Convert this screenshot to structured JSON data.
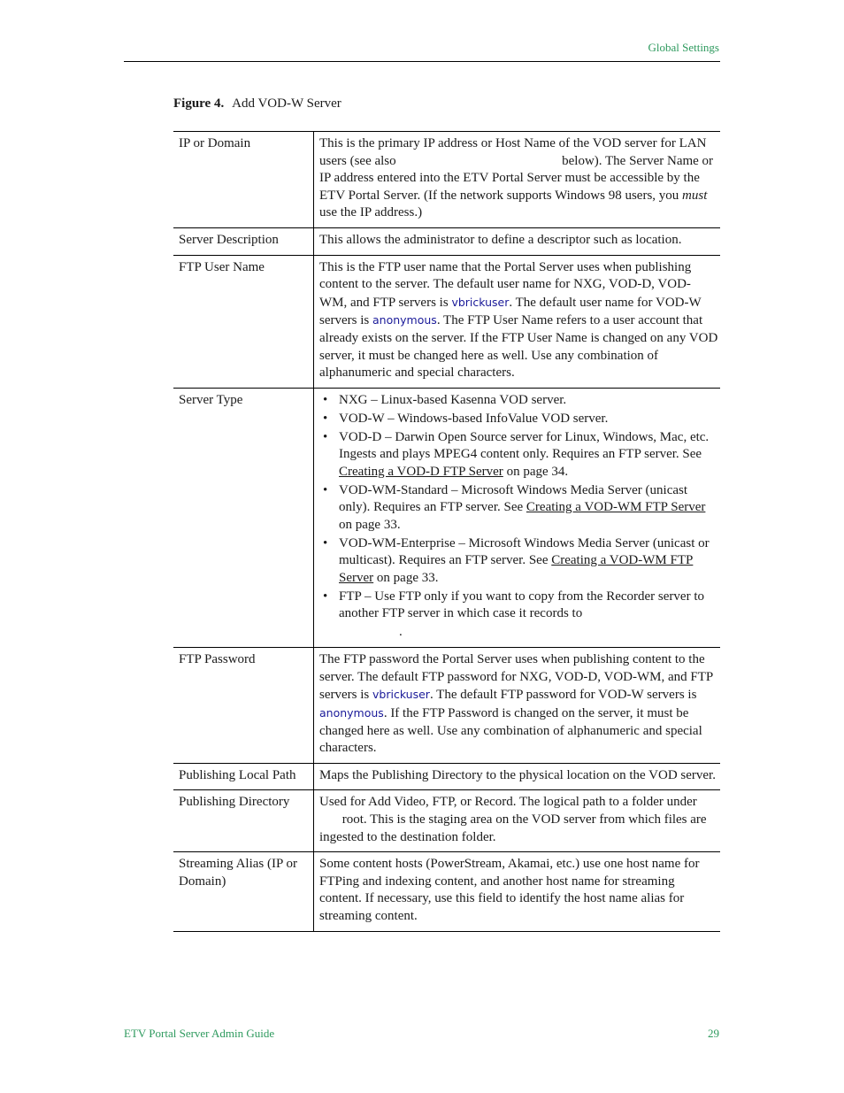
{
  "header": {
    "section_title": "Global Settings"
  },
  "figure": {
    "number": "Figure 4.",
    "title": "Add VOD-W Server"
  },
  "rows": [
    {
      "label": "IP or Domain",
      "p1": "This is the primary IP address or Host Name of the VOD server for LAN users (see also",
      "p2": "below). The Server Name or IP address entered into the ETV Portal Server must be accessible by the ETV Portal Server. (If the network supports Windows 98 users, you",
      "em": "must",
      "p3": "use the IP address.)"
    },
    {
      "label": "Server Description",
      "text": "This allows the administrator to define a descriptor such as location."
    },
    {
      "label": "FTP User Name",
      "p1": "This is the FTP user name that the Portal Server uses when publishing content to the server. The default user name for NXG, VOD-D, VOD-WM, and FTP servers is",
      "code1": "vbrickuser",
      "p2": ". The default user name for VOD-W servers is",
      "code2": "anonymous",
      "p3": ". The FTP User Name refers to a user account that already exists on the server. If the FTP User Name is changed on any VOD server, it must be changed here as well. Use any combination of alphanumeric and special characters."
    },
    {
      "label": "Server Type",
      "items": [
        {
          "text": "NXG – Linux-based Kasenna VOD server."
        },
        {
          "text": "VOD-W – Windows-based InfoValue VOD server."
        },
        {
          "text": "VOD-D – Darwin Open Source server for Linux, Windows, Mac, etc. Ingests and plays MPEG4 content only. Requires an FTP server. See",
          "link": "Creating a VOD-D FTP Server",
          "after": "on page 34."
        },
        {
          "text": "VOD-WM-Standard – Microsoft Windows Media Server (unicast only). Requires an FTP server. See",
          "link": "Creating a VOD-WM FTP Server",
          "after": "on page 33."
        },
        {
          "text": "VOD-WM-Enterprise – Microsoft Windows Media Server (unicast or multicast). Requires an FTP server. See",
          "link": "Creating a VOD-WM FTP Server",
          "after": "on page 33."
        },
        {
          "text": "FTP – Use FTP only if you want to copy from the Recorder server to another FTP server in which case it records to"
        }
      ],
      "trailing": "."
    },
    {
      "label": "FTP Password",
      "p1": "The FTP password the Portal Server uses when publishing content to the server. The default FTP password for NXG, VOD-D, VOD-WM, and FTP servers is",
      "code1": "vbrickuser",
      "p2": ". The default FTP password for VOD-W servers is",
      "code2": "anonymous",
      "p3": ". If the FTP Password is changed on the server, it must be changed here as well. Use any combination of alphanumeric and special characters."
    },
    {
      "label": "Publishing Local Path",
      "text": "Maps the Publishing Directory to the physical location on the VOD server."
    },
    {
      "label": "Publishing Directory",
      "p1": "Used for Add Video, FTP, or Record. The logical path to a folder under",
      "p2": "root. This is the staging area on the VOD server from which files are ingested to the destination folder."
    },
    {
      "label": "Streaming Alias (IP or Domain)",
      "text": "Some content hosts (PowerStream, Akamai, etc.) use one host name for FTPing and indexing content, and another host name for streaming content. If necessary, use this field to identify the host name alias for streaming content."
    }
  ],
  "footer": {
    "doc_title": "ETV Portal Server Admin Guide",
    "page_number": "29"
  }
}
